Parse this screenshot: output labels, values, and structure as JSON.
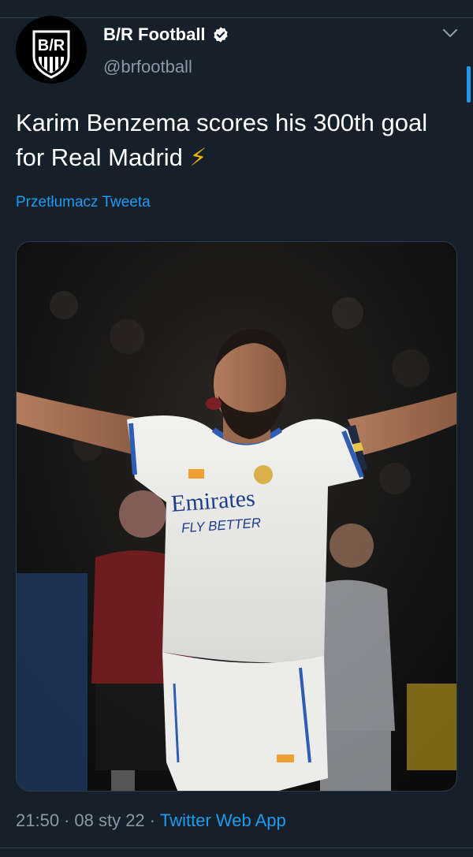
{
  "tweet": {
    "display_name": "B/R Football",
    "handle": "@brfootball",
    "text": "Karim Benzema scores his 300th goal for Real Madrid",
    "emoji": "⚡",
    "translate_label": "Przetłumacz Tweeta",
    "time": "21:50",
    "separator": "·",
    "date": "08 sty 22",
    "source": "Twitter Web App"
  },
  "avatar": {
    "logo_text": "B/R"
  },
  "media": {
    "jersey_sponsor": "Emirates",
    "jersey_tagline": "FLY BETTER"
  },
  "icons": {
    "verified": "verified-badge-icon",
    "menu": "chevron-down-icon"
  },
  "colors": {
    "background": "#15202b",
    "accent": "#1d9bf0",
    "secondary_text": "#8b98a5",
    "divider": "#38444d"
  }
}
